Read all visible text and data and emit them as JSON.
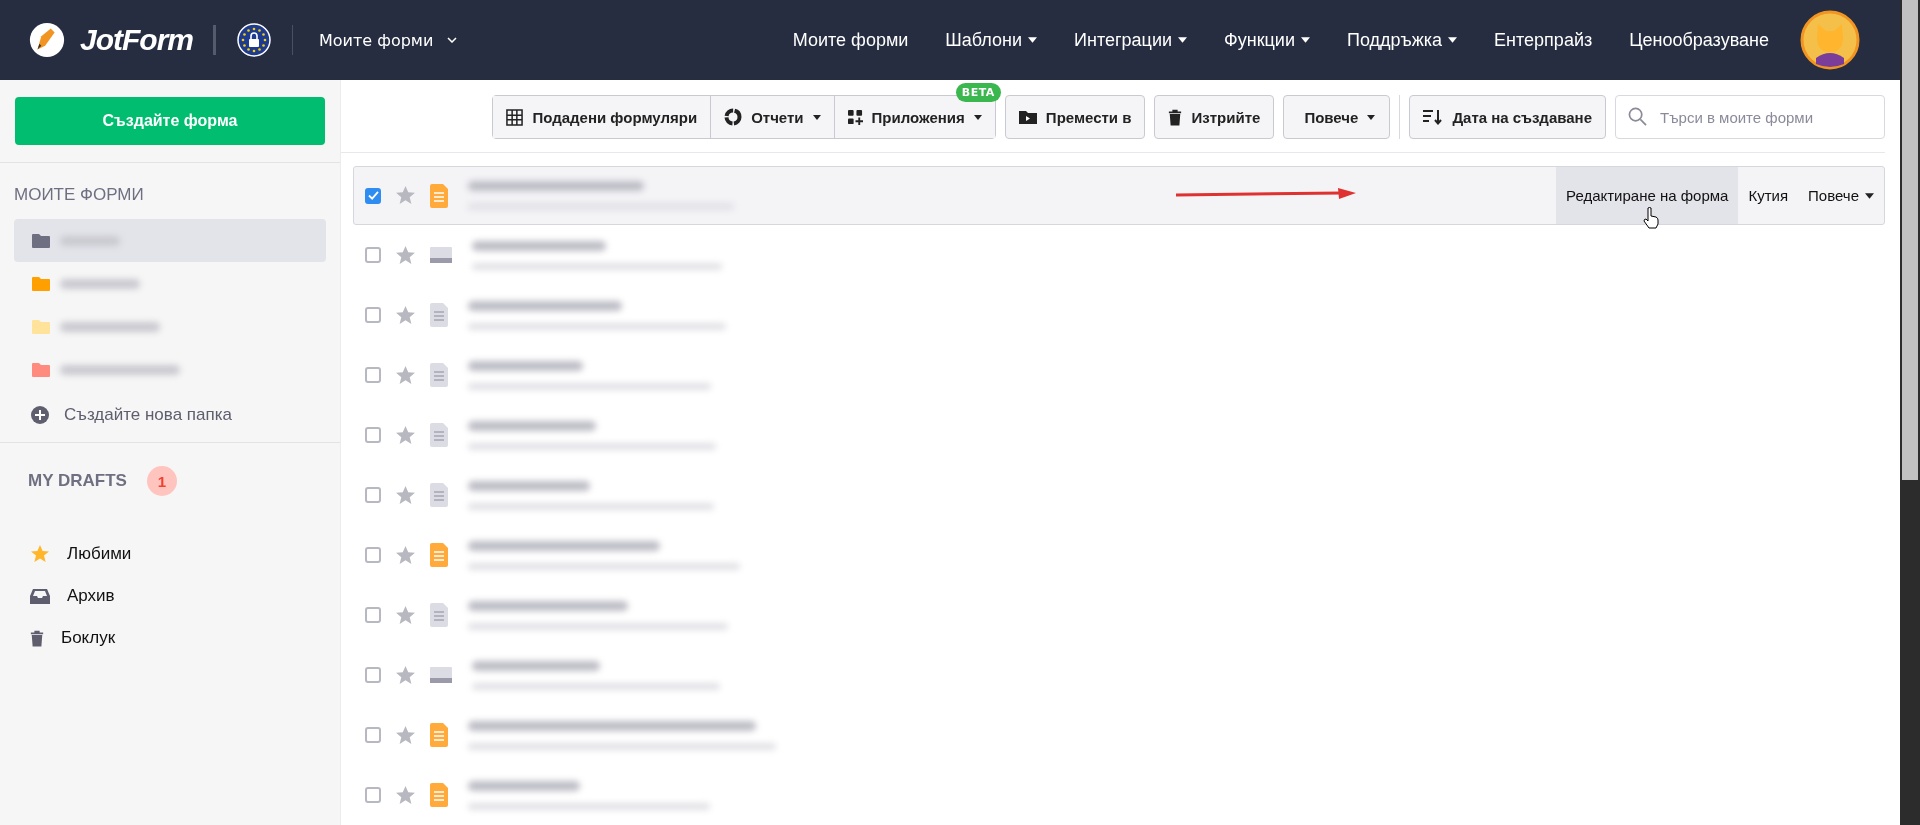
{
  "header": {
    "brand": "JotForm",
    "context_menu": "Моите форми",
    "nav": [
      {
        "label": "Моите форми",
        "dropdown": false
      },
      {
        "label": "Шаблони",
        "dropdown": true
      },
      {
        "label": "Интеграции",
        "dropdown": true
      },
      {
        "label": "Функции",
        "dropdown": true
      },
      {
        "label": "Поддръжка",
        "dropdown": true
      },
      {
        "label": "Ентерпрайз",
        "dropdown": false
      },
      {
        "label": "Ценообразуване",
        "dropdown": false
      }
    ]
  },
  "sidebar": {
    "create_button": "Създайте форма",
    "section_title": "МОИТЕ ФОРМИ",
    "folders": [
      {
        "color": "#6f6f82",
        "selected": true
      },
      {
        "color": "#ff9f00",
        "selected": false
      },
      {
        "color": "#ffe39b",
        "selected": false
      },
      {
        "color": "#ff8b7e",
        "selected": false
      }
    ],
    "new_folder": "Създайте нова папка",
    "drafts_title": "MY DRAFTS",
    "drafts_count": "1",
    "links": [
      {
        "kind": "star",
        "label": "Любими"
      },
      {
        "kind": "inbox",
        "label": "Архив"
      },
      {
        "kind": "trash",
        "label": "Боклук"
      }
    ]
  },
  "toolbar": {
    "group": [
      {
        "kind": "grid",
        "label": "Подадени формуляри",
        "dropdown": false
      },
      {
        "kind": "reports",
        "label": "Отчети",
        "dropdown": true
      },
      {
        "kind": "apps",
        "label": "Приложения",
        "dropdown": true,
        "badge": "BETA"
      }
    ],
    "move": "Премести в",
    "delete": "Изтрийте",
    "more": "Повече",
    "sort": "Дата на създаване",
    "search": {
      "placeholder": "Търси в моите форми"
    }
  },
  "forms": [
    {
      "checked": true,
      "kind": "form",
      "selected": true
    },
    {
      "checked": false,
      "kind": "card",
      "selected": false
    },
    {
      "checked": false,
      "kind": "doc",
      "selected": false
    },
    {
      "checked": false,
      "kind": "doc",
      "selected": false
    },
    {
      "checked": false,
      "kind": "doc",
      "selected": false
    },
    {
      "checked": false,
      "kind": "doc",
      "selected": false
    },
    {
      "checked": false,
      "kind": "form",
      "selected": false
    },
    {
      "checked": false,
      "kind": "doc",
      "selected": false
    },
    {
      "checked": false,
      "kind": "card",
      "selected": false
    },
    {
      "checked": false,
      "kind": "form",
      "selected": false
    },
    {
      "checked": false,
      "kind": "form",
      "selected": false
    }
  ],
  "row_actions": [
    {
      "label": "Редактиране на форма",
      "highlighted": true,
      "dropdown": false
    },
    {
      "label": "Кутия",
      "highlighted": false,
      "dropdown": false
    },
    {
      "label": "Повече",
      "highlighted": false,
      "dropdown": true
    }
  ]
}
